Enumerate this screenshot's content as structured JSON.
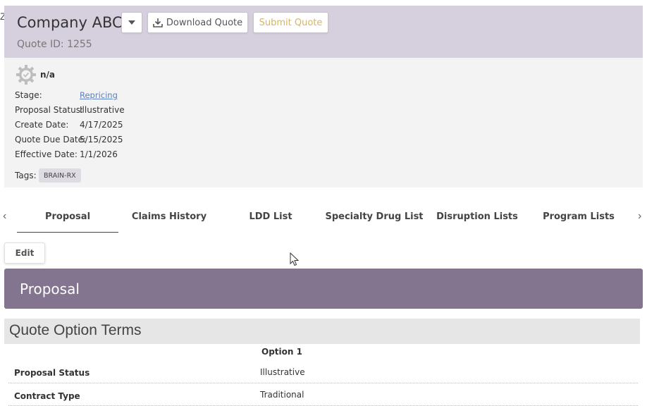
{
  "header": {
    "edge_mark": "Z",
    "company": "Company ABC",
    "quote_id": "Quote ID: 1255",
    "download_label": "Download Quote",
    "submit_label": "Submit Quote"
  },
  "status": {
    "icon": "gear-icon",
    "label": "n/a"
  },
  "fields": {
    "stage_label": "Stage:",
    "stage_value": "Repricing",
    "proposal_status_label": "Proposal Status:",
    "proposal_status_value": "Illustrative",
    "create_date_label": "Create Date:",
    "create_date_value": "4/17/2025",
    "due_date_label": "Quote Due Date:",
    "due_date_value": "5/15/2025",
    "effective_date_label": "Effective Date:",
    "effective_date_value": "1/1/2026"
  },
  "tags": {
    "label": "Tags:",
    "items": [
      "BRAIN-RX"
    ]
  },
  "tabs": [
    "Proposal",
    "Claims History",
    "LDD List",
    "Specialty Drug List",
    "Disruption Lists",
    "Program Lists"
  ],
  "edit_label": "Edit",
  "section": {
    "title": "Proposal"
  },
  "terms": {
    "title": "Quote Option Terms",
    "option_header": "Option 1",
    "rows": [
      {
        "label": "Proposal Status",
        "value": "Illustrative"
      },
      {
        "label": "Contract Type",
        "value": "Traditional"
      }
    ]
  },
  "colors": {
    "header_bg": "#d6d0de",
    "banner_bg": "#837590",
    "submit_text": "#d4b56a",
    "link": "#5b7fbf"
  }
}
